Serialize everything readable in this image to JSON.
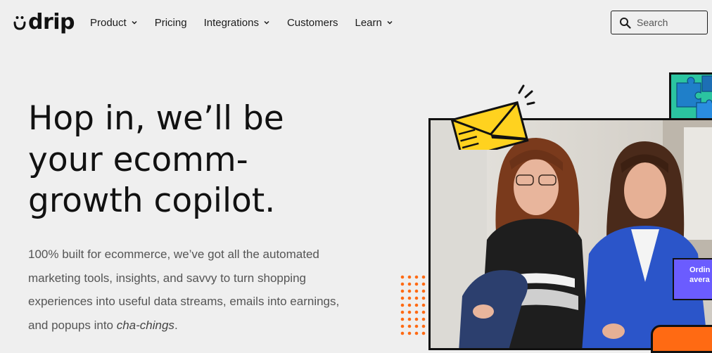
{
  "brand": {
    "name": "drip"
  },
  "nav": {
    "items": [
      {
        "label": "Product",
        "has_dropdown": true
      },
      {
        "label": "Pricing",
        "has_dropdown": false
      },
      {
        "label": "Integrations",
        "has_dropdown": true
      },
      {
        "label": "Customers",
        "has_dropdown": false
      },
      {
        "label": "Learn",
        "has_dropdown": true
      }
    ]
  },
  "search": {
    "placeholder": "Search",
    "icon": "search-icon"
  },
  "hero": {
    "headline_lines": [
      "Hop in, we’ll be",
      "your ecomm-",
      "growth copilot."
    ],
    "subtext_main": "100% built for ecommerce, we’ve got all the automated marketing tools, insights, and savvy to turn shopping experiences into useful data streams, emails into earnings, and popups into ",
    "subtext_em": "cha-chings",
    "subtext_end": "."
  },
  "promo_card": {
    "line1": "Ordin",
    "line2": "avera"
  },
  "colors": {
    "background": "#efefef",
    "text": "#1c1c1c",
    "muted_text": "#555555",
    "accent_orange": "#ff6a13",
    "accent_yellow": "#ffd21f",
    "accent_purple": "#6b5cff",
    "accent_teal": "#2bc4a0"
  }
}
